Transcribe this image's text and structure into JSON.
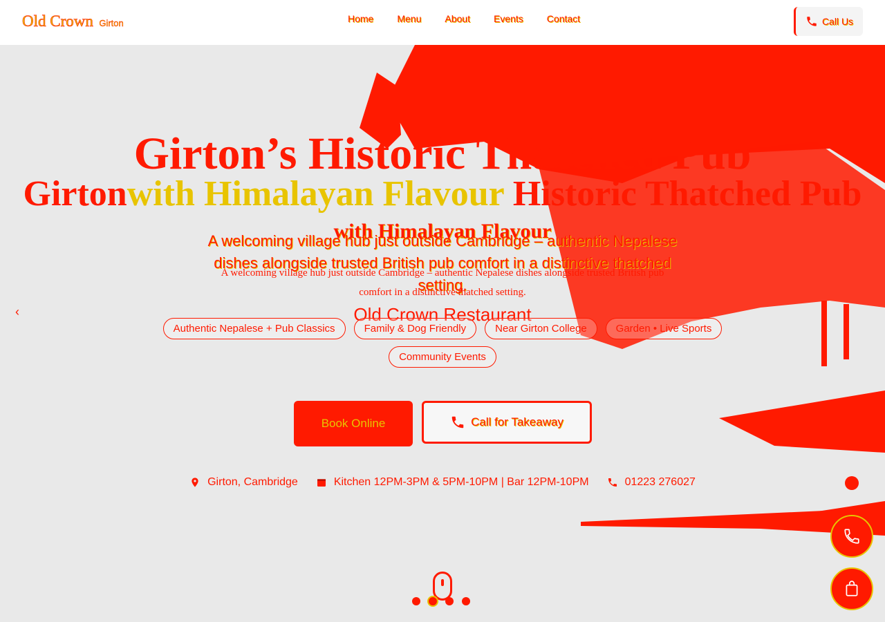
{
  "brand": {
    "name": "Old Crown",
    "location": "Girton"
  },
  "nav": {
    "items": [
      "Home",
      "Menu",
      "About",
      "Events",
      "Contact"
    ]
  },
  "header": {
    "call_label": "Call Us"
  },
  "hero": {
    "title": "Girton’s Historic Thatched Pub",
    "title_repeat_a": "Girton",
    "title_repeat_b": "with Himalayan Flavour",
    "title_repeat_c": "Historic Thatched Pub",
    "tagline": "with Himalayan Flavour",
    "description": "A welcoming village hub just outside Cambridge – authentic Nepalese dishes alongside trusted British pub comfort in a distinctive thatched setting.",
    "restaurant_name": "Old Crown Restaurant",
    "prev_arrow": "‹",
    "tags": [
      "Authentic Nepalese + Pub Classics",
      "Family & Dog Friendly",
      "Near Girton College",
      "Garden • Live Sports",
      "Community Events"
    ],
    "book_label": "Book Online",
    "takeaway_label": "Call for Takeaway"
  },
  "info": {
    "location": "Girton, Cambridge",
    "hours": "Kitchen 12PM-3PM & 5PM-10PM | Bar 12PM-10PM",
    "phone": "01223 276027"
  },
  "icons": {
    "phone": "phone-icon",
    "pin": "map-pin-icon",
    "calendar": "calendar-icon",
    "order": "shopping-bag-icon",
    "scroll": "mouse-scroll-icon"
  },
  "colors": {
    "accent": "#ff1a00",
    "highlight": "#e8c400",
    "background": "#e9e9e9",
    "header": "#ffffff"
  },
  "slider": {
    "slides": 4,
    "active": 2
  }
}
